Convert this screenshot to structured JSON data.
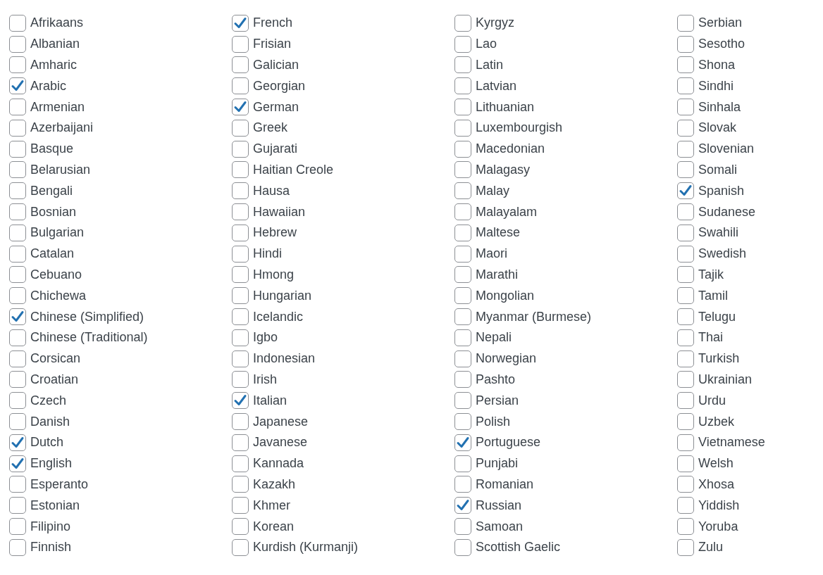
{
  "languages": [
    {
      "label": "Afrikaans",
      "checked": false
    },
    {
      "label": "Albanian",
      "checked": false
    },
    {
      "label": "Amharic",
      "checked": false
    },
    {
      "label": "Arabic",
      "checked": true
    },
    {
      "label": "Armenian",
      "checked": false
    },
    {
      "label": "Azerbaijani",
      "checked": false
    },
    {
      "label": "Basque",
      "checked": false
    },
    {
      "label": "Belarusian",
      "checked": false
    },
    {
      "label": "Bengali",
      "checked": false
    },
    {
      "label": "Bosnian",
      "checked": false
    },
    {
      "label": "Bulgarian",
      "checked": false
    },
    {
      "label": "Catalan",
      "checked": false
    },
    {
      "label": "Cebuano",
      "checked": false
    },
    {
      "label": "Chichewa",
      "checked": false
    },
    {
      "label": "Chinese (Simplified)",
      "checked": true
    },
    {
      "label": "Chinese (Traditional)",
      "checked": false
    },
    {
      "label": "Corsican",
      "checked": false
    },
    {
      "label": "Croatian",
      "checked": false
    },
    {
      "label": "Czech",
      "checked": false
    },
    {
      "label": "Danish",
      "checked": false
    },
    {
      "label": "Dutch",
      "checked": true
    },
    {
      "label": "English",
      "checked": true
    },
    {
      "label": "Esperanto",
      "checked": false
    },
    {
      "label": "Estonian",
      "checked": false
    },
    {
      "label": "Filipino",
      "checked": false
    },
    {
      "label": "Finnish",
      "checked": false
    },
    {
      "label": "French",
      "checked": true
    },
    {
      "label": "Frisian",
      "checked": false
    },
    {
      "label": "Galician",
      "checked": false
    },
    {
      "label": "Georgian",
      "checked": false
    },
    {
      "label": "German",
      "checked": true
    },
    {
      "label": "Greek",
      "checked": false
    },
    {
      "label": "Gujarati",
      "checked": false
    },
    {
      "label": "Haitian Creole",
      "checked": false
    },
    {
      "label": "Hausa",
      "checked": false
    },
    {
      "label": "Hawaiian",
      "checked": false
    },
    {
      "label": "Hebrew",
      "checked": false
    },
    {
      "label": "Hindi",
      "checked": false
    },
    {
      "label": "Hmong",
      "checked": false
    },
    {
      "label": "Hungarian",
      "checked": false
    },
    {
      "label": "Icelandic",
      "checked": false
    },
    {
      "label": "Igbo",
      "checked": false
    },
    {
      "label": "Indonesian",
      "checked": false
    },
    {
      "label": "Irish",
      "checked": false
    },
    {
      "label": "Italian",
      "checked": true
    },
    {
      "label": "Japanese",
      "checked": false
    },
    {
      "label": "Javanese",
      "checked": false
    },
    {
      "label": "Kannada",
      "checked": false
    },
    {
      "label": "Kazakh",
      "checked": false
    },
    {
      "label": "Khmer",
      "checked": false
    },
    {
      "label": "Korean",
      "checked": false
    },
    {
      "label": "Kurdish (Kurmanji)",
      "checked": false
    },
    {
      "label": "Kyrgyz",
      "checked": false
    },
    {
      "label": "Lao",
      "checked": false
    },
    {
      "label": "Latin",
      "checked": false
    },
    {
      "label": "Latvian",
      "checked": false
    },
    {
      "label": "Lithuanian",
      "checked": false
    },
    {
      "label": "Luxembourgish",
      "checked": false
    },
    {
      "label": "Macedonian",
      "checked": false
    },
    {
      "label": "Malagasy",
      "checked": false
    },
    {
      "label": "Malay",
      "checked": false
    },
    {
      "label": "Malayalam",
      "checked": false
    },
    {
      "label": "Maltese",
      "checked": false
    },
    {
      "label": "Maori",
      "checked": false
    },
    {
      "label": "Marathi",
      "checked": false
    },
    {
      "label": "Mongolian",
      "checked": false
    },
    {
      "label": "Myanmar (Burmese)",
      "checked": false
    },
    {
      "label": "Nepali",
      "checked": false
    },
    {
      "label": "Norwegian",
      "checked": false
    },
    {
      "label": "Pashto",
      "checked": false
    },
    {
      "label": "Persian",
      "checked": false
    },
    {
      "label": "Polish",
      "checked": false
    },
    {
      "label": "Portuguese",
      "checked": true
    },
    {
      "label": "Punjabi",
      "checked": false
    },
    {
      "label": "Romanian",
      "checked": false
    },
    {
      "label": "Russian",
      "checked": true
    },
    {
      "label": "Samoan",
      "checked": false
    },
    {
      "label": "Scottish Gaelic",
      "checked": false
    },
    {
      "label": "Serbian",
      "checked": false
    },
    {
      "label": "Sesotho",
      "checked": false
    },
    {
      "label": "Shona",
      "checked": false
    },
    {
      "label": "Sindhi",
      "checked": false
    },
    {
      "label": "Sinhala",
      "checked": false
    },
    {
      "label": "Slovak",
      "checked": false
    },
    {
      "label": "Slovenian",
      "checked": false
    },
    {
      "label": "Somali",
      "checked": false
    },
    {
      "label": "Spanish",
      "checked": true
    },
    {
      "label": "Sudanese",
      "checked": false
    },
    {
      "label": "Swahili",
      "checked": false
    },
    {
      "label": "Swedish",
      "checked": false
    },
    {
      "label": "Tajik",
      "checked": false
    },
    {
      "label": "Tamil",
      "checked": false
    },
    {
      "label": "Telugu",
      "checked": false
    },
    {
      "label": "Thai",
      "checked": false
    },
    {
      "label": "Turkish",
      "checked": false
    },
    {
      "label": "Ukrainian",
      "checked": false
    },
    {
      "label": "Urdu",
      "checked": false
    },
    {
      "label": "Uzbek",
      "checked": false
    },
    {
      "label": "Vietnamese",
      "checked": false
    },
    {
      "label": "Welsh",
      "checked": false
    },
    {
      "label": "Xhosa",
      "checked": false
    },
    {
      "label": "Yiddish",
      "checked": false
    },
    {
      "label": "Yoruba",
      "checked": false
    },
    {
      "label": "Zulu",
      "checked": false
    }
  ]
}
